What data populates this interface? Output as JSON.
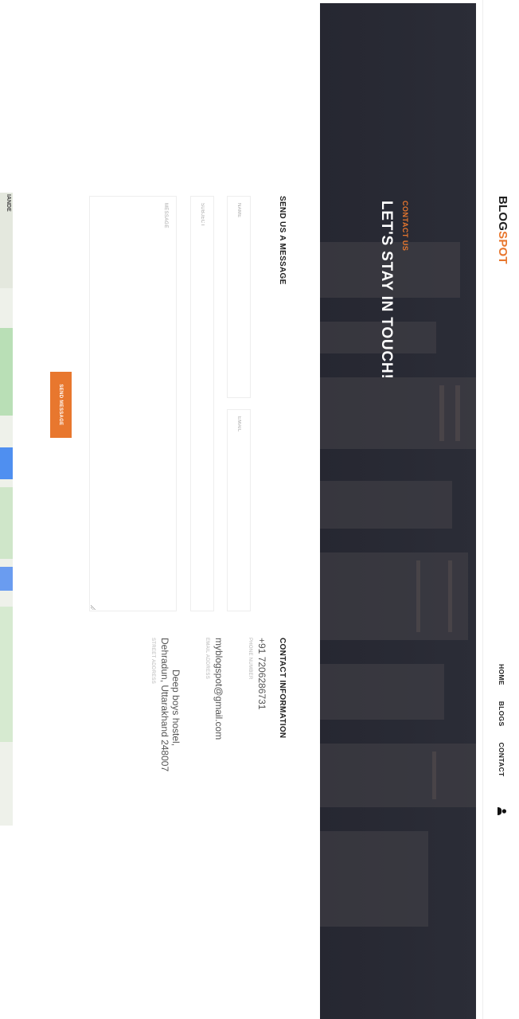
{
  "nav": {
    "logo_part1": "BLOG",
    "logo_part2": "SPOT",
    "menu": [
      "HOME",
      "BLOGS",
      "CONTACT"
    ],
    "user_icon": "user-icon"
  },
  "hero": {
    "kicker": "CONTACT US",
    "headline": "LET'S STAY IN TOUCH!"
  },
  "form": {
    "title": "SEND US A MESSAGE",
    "name_placeholder": "NAME",
    "email_placeholder": "EMAIL",
    "subject_placeholder": "SUBJECT",
    "message_placeholder": "MESSAGE",
    "send_label": "SEND MESSAGE"
  },
  "contact_info": {
    "title": "CONTACT INFORMATION",
    "phone": "+91 7206286731",
    "phone_label": "PHONE NUMBER",
    "email": "myblogspot@gmail.com",
    "email_label": "EMAIL ADDRESS",
    "address_line1": "Deep boys hostel,",
    "address_line2": "Dehradun, Uttarakhand 248007",
    "address_label": "STREET ADDRESS"
  },
  "map": {
    "label": "IANDE"
  },
  "colors": {
    "accent": "#e8772e",
    "hero_bg": "#2b2d37"
  }
}
